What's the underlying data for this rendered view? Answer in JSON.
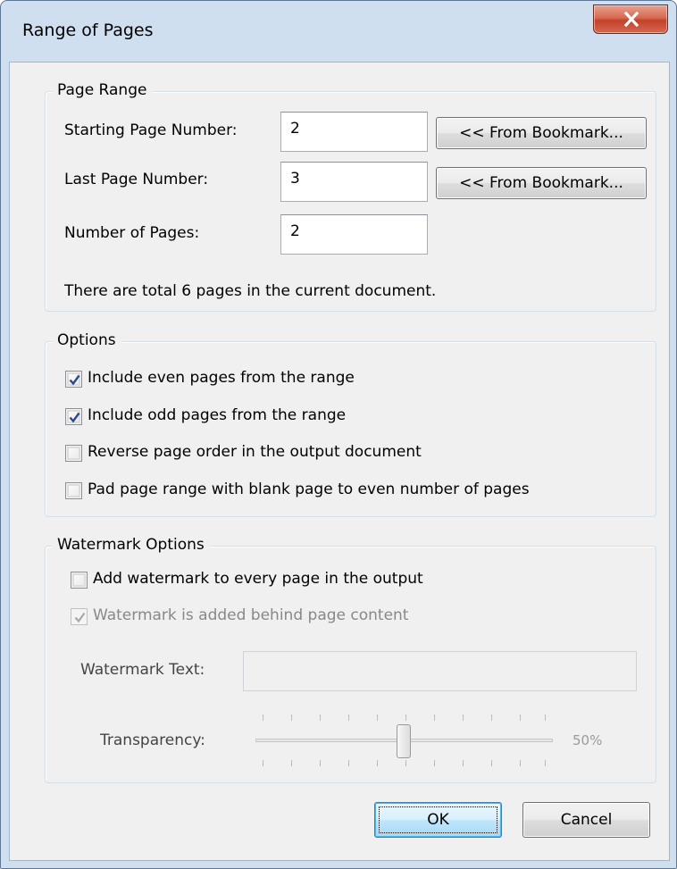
{
  "window": {
    "title": "Range of Pages",
    "close_icon": "close-icon"
  },
  "page_range": {
    "legend": "Page Range",
    "starting_label": "Starting Page Number:",
    "starting_value": "2",
    "last_label": "Last Page Number:",
    "last_value": "3",
    "count_label": "Number of Pages:",
    "count_value": "2",
    "from_bookmark_label": "<< From Bookmark...",
    "info_text": "There are total 6 pages in the current document."
  },
  "options": {
    "legend": "Options",
    "items": [
      {
        "label": "Include even pages from the range",
        "checked": true
      },
      {
        "label": "Include odd pages from the range",
        "checked": true
      },
      {
        "label": "Reverse page order in the output document",
        "checked": false
      },
      {
        "label": "Pad page range with blank page to even number of pages",
        "checked": false
      }
    ]
  },
  "watermark": {
    "legend": "Watermark Options",
    "add_label": "Add watermark to every page in the output",
    "add_checked": false,
    "behind_label": "Watermark is added behind page content",
    "behind_checked": true,
    "text_label": "Watermark Text:",
    "text_value": "",
    "transparency_label": "Transparency:",
    "transparency_value": 0.5,
    "transparency_text": "50%"
  },
  "buttons": {
    "ok": "OK",
    "cancel": "Cancel"
  }
}
